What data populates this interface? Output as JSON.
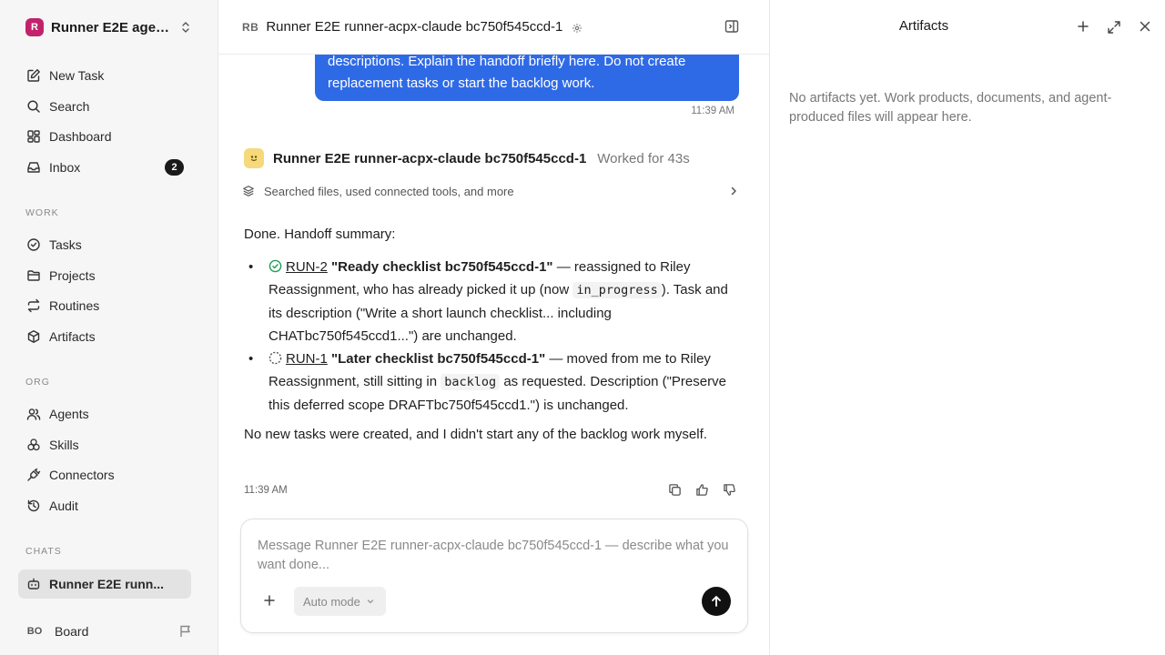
{
  "workspace": {
    "logo_letter": "R",
    "name": "Runner E2E agen..."
  },
  "nav": {
    "new_task": "New Task",
    "search": "Search",
    "dashboard": "Dashboard",
    "inbox": "Inbox",
    "inbox_count": "2"
  },
  "sections": {
    "work": "WORK",
    "org": "ORG",
    "chats": "CHATS"
  },
  "work_items": {
    "tasks": "Tasks",
    "projects": "Projects",
    "routines": "Routines",
    "artifacts": "Artifacts"
  },
  "org_items": {
    "agents": "Agents",
    "skills": "Skills",
    "connectors": "Connectors",
    "audit": "Audit"
  },
  "chats": {
    "active": "Runner E2E runn..."
  },
  "user": {
    "initials": "BO",
    "name": "Board"
  },
  "chat": {
    "header_initials": "RB",
    "title": "Runner E2E runner-acpx-claude bc750f545ccd-1",
    "user_message": "descriptions. Explain the handoff briefly here. Do not create replacement tasks or start the backlog work.",
    "user_time": "11:39 AM",
    "agent_name": "Runner E2E runner-acpx-claude bc750f545ccd-1",
    "worked": "Worked for 43s",
    "tools_summary": "Searched files, used connected tools, and more",
    "intro": "Done. Handoff summary:",
    "item1": {
      "link": "RUN-2",
      "title": "\"Ready checklist bc750f545ccd-1\"",
      "text_a": " — reassigned to Riley Reassignment, who has already picked it up (now ",
      "code": "in_progress",
      "text_b": "). Task and its description (\"Write a short launch checklist... including CHATbc750f545ccd1...\") are unchanged."
    },
    "item2": {
      "link": "RUN-1",
      "title": "\"Later checklist bc750f545ccd-1\"",
      "text_a": " — moved from me to Riley Reassignment, still sitting in ",
      "code": "backlog",
      "text_b": " as requested. Description (\"Preserve this deferred scope DRAFTbc750f545ccd1.\") is unchanged."
    },
    "outro": "No new tasks were created, and I didn't start any of the backlog work myself.",
    "agent_time": "11:39 AM"
  },
  "composer": {
    "placeholder": "Message Runner E2E runner-acpx-claude bc750f545ccd-1 — describe what you want done...",
    "mode": "Auto mode"
  },
  "artifacts_panel": {
    "title": "Artifacts",
    "empty": "No artifacts yet. Work products, documents, and agent-produced files will appear here."
  }
}
